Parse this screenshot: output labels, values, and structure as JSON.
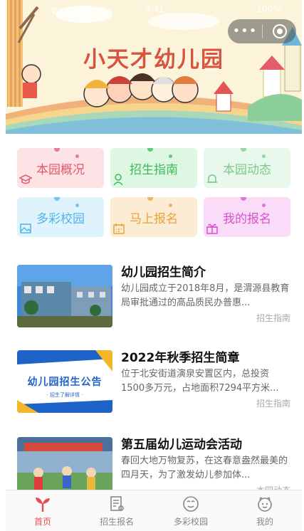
{
  "status": {
    "carrier": "WeChat令",
    "time": "9:41",
    "battery": "100%"
  },
  "banner": {
    "title": "小天才幼儿园"
  },
  "capsule": {
    "more_icon": "more-dots-icon",
    "close_icon": "target-icon"
  },
  "tiles": [
    {
      "label": "本园概况",
      "bg": "#fde3e6",
      "fg": "#e2586a",
      "icon": "graduation-cap-icon"
    },
    {
      "label": "招生指南",
      "bg": "#def7e3",
      "fg": "#3cba5b",
      "icon": "person-icon"
    },
    {
      "label": "本园动态",
      "bg": "#e9f8ec",
      "fg": "#7bc98a",
      "icon": "bell-icon"
    },
    {
      "label": "多彩校园",
      "bg": "#dff3fc",
      "fg": "#52b3e8",
      "icon": "image-icon"
    },
    {
      "label": "马上报名",
      "bg": "#fdecd4",
      "fg": "#e6a33b",
      "icon": "calendar-icon"
    },
    {
      "label": "我的报名",
      "bg": "#fbdcf8",
      "fg": "#d653cc",
      "icon": "gift-icon"
    }
  ],
  "news": [
    {
      "title": "幼儿园招生简介",
      "desc": "幼儿园成立于2018年8月，是渭源县教育局审批通过的高品质民办普惠...",
      "tag": "招生指南"
    },
    {
      "title": "2022年秋季招生简章",
      "desc": "位于北安街道演泉安置区内，总投资1500多万元，占地面积7294平方米...",
      "tag": "招生指南",
      "thumb_text": "幼儿园招生公告",
      "thumb_sub": "· 招生了解详情 ·"
    },
    {
      "title": "第五届幼儿运动会活动",
      "desc": "春回大地万物复苏，在这春意盎然最美的四月天，为了激发幼儿参加体...",
      "tag": "本园动态"
    }
  ],
  "tabbar": [
    {
      "label": "首页",
      "icon": "sprout-icon",
      "active": true
    },
    {
      "label": "招生报名",
      "icon": "form-icon",
      "active": false
    },
    {
      "label": "多彩校园",
      "icon": "face-icon",
      "active": false
    },
    {
      "label": "我的",
      "icon": "smile-icon",
      "active": false
    }
  ],
  "colors": {
    "accent": "#e94d4d",
    "title_red": "#d7553a"
  }
}
